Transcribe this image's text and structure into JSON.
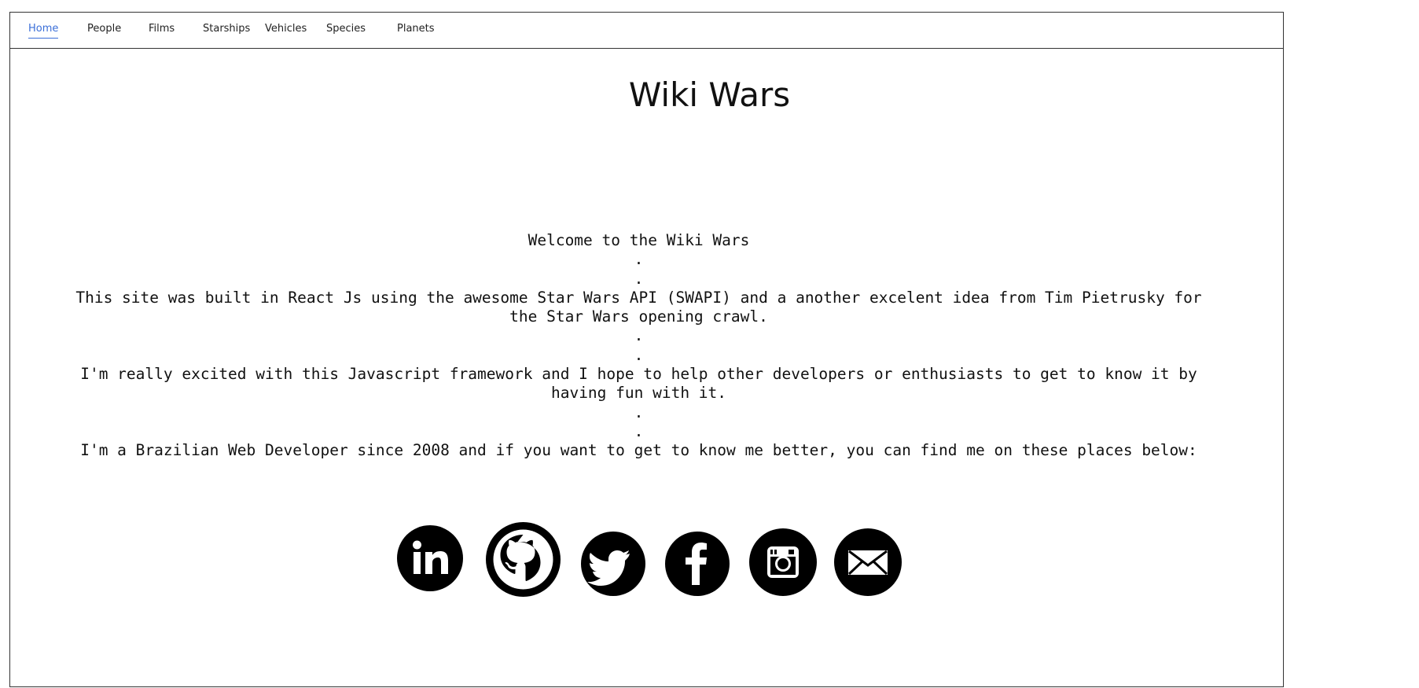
{
  "nav": {
    "items": [
      {
        "label": "Home",
        "active": true
      },
      {
        "label": "People",
        "active": false
      },
      {
        "label": "Films",
        "active": false
      },
      {
        "label": "Starships",
        "active": false
      },
      {
        "label": "Vehicles",
        "active": false
      },
      {
        "label": "Species",
        "active": false
      },
      {
        "label": "Planets",
        "active": false
      }
    ],
    "active_color": "#3b6fd8"
  },
  "page": {
    "title": "Wiki Wars"
  },
  "intro": {
    "welcome": "Welcome to the Wiki Wars",
    "dot": ".",
    "built_with": "This site was built in React Js using the awesome Star Wars API (SWAPI) and a another excelent idea from Tim Pietrusky for the Star Wars opening crawl.",
    "excited": "I'm really excited with this Javascript framework and I hope to help other developers or enthusiasts to get to know it by having fun with it.",
    "find_me": "I'm a Brazilian Web Developer since 2008 and if you want to get to know me better, you can find me on these places below:"
  },
  "social": [
    {
      "icon": "linkedin-icon"
    },
    {
      "icon": "github-icon"
    },
    {
      "icon": "twitter-icon"
    },
    {
      "icon": "facebook-icon"
    },
    {
      "icon": "instagram-icon"
    },
    {
      "icon": "email-icon"
    }
  ]
}
